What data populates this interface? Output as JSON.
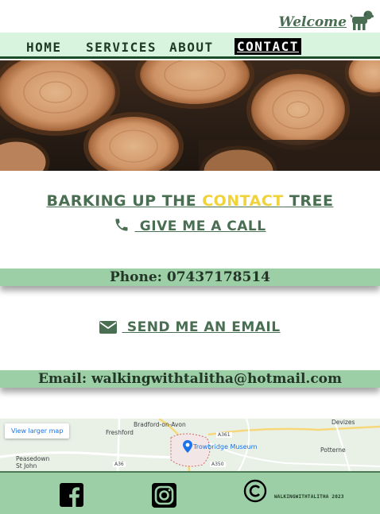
{
  "header": {
    "welcome": "Welcome"
  },
  "nav": {
    "items": [
      {
        "label": "HOME"
      },
      {
        "label": "SERVICES"
      },
      {
        "label": "ABOUT"
      },
      {
        "label": "CONTACT",
        "active": true
      }
    ]
  },
  "hero": {
    "image": "cut-logs-photo"
  },
  "contact": {
    "title_pre": "BARKING UP THE ",
    "title_highlight": "CONTACT",
    "title_post": " TREE",
    "call_label": " GIVE ME A CALL",
    "phone_text": "Phone: 07437178514",
    "email_label": " SEND ME AN EMAIL",
    "email_text": "Email: walkingwithtalitha@hotmail.com"
  },
  "map": {
    "larger_map": "View larger map",
    "places": {
      "bradford": "Bradford-on-Avon",
      "devizes": "Devizes",
      "freshford": "Freshford",
      "peasedown": "Peasedown\nSt John",
      "trowbridge_museum": "Trowbridge Museum",
      "potterne": "Potterne",
      "a361": "A361",
      "a36": "A36",
      "a350": "A350"
    }
  },
  "footer": {
    "credit": "WALKINGWITHTALITHA 2023"
  },
  "colors": {
    "accent_green": "#4a6e52",
    "nav_bg": "#d9f4de",
    "band_bg": "#9ccfa6",
    "highlight": "#f0d23a"
  }
}
